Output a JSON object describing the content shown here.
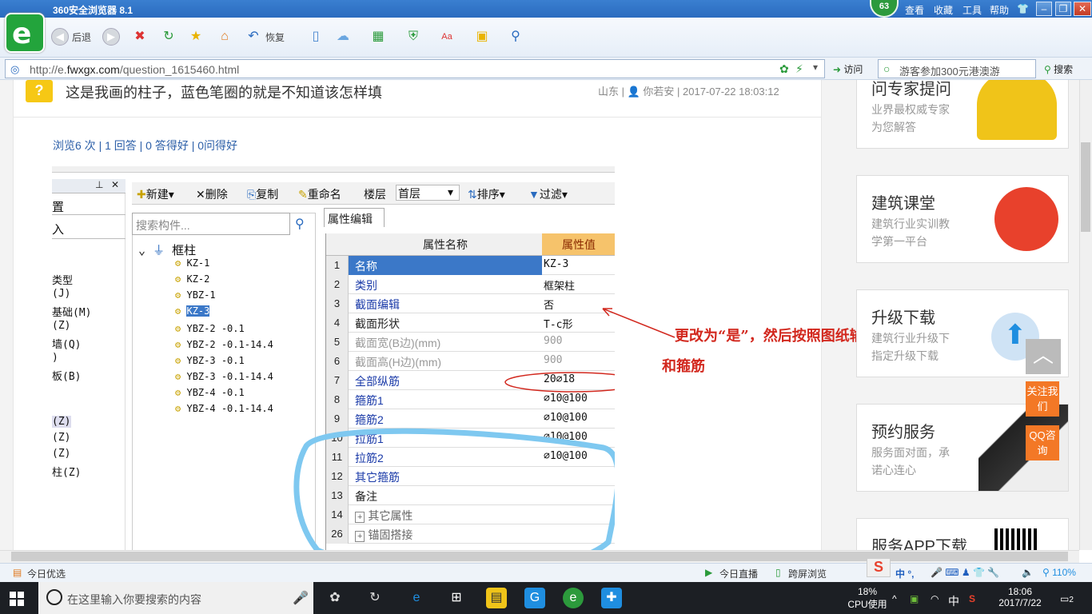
{
  "window": {
    "title": "360安全浏览器 8.1",
    "badge": "63",
    "menu": [
      "查看",
      "收藏",
      "工具",
      "帮助"
    ]
  },
  "toolbar": {
    "back": "后退",
    "restore": "恢复"
  },
  "address": {
    "url_prefix": "http://e.",
    "url_domain": "fwxgx.com",
    "url_path": "/question_1615460.html",
    "visit": "访问",
    "search_placeholder": "游客参加300元港澳游",
    "search_button": "搜索"
  },
  "question": {
    "title": "这是我画的柱子，蓝色笔圈的就是不知道该怎样填",
    "meta": "山东 | 👤 你若安 | 2017-07-22 18:03:12",
    "stats": "浏览6 次 | 1 回答 | 0 答得好 | 0问得好"
  },
  "screenshot": {
    "left_items": [
      "置",
      "入",
      "类型",
      "(J)",
      "基础(M)",
      "(Z)",
      "墙(Q)",
      ")",
      "板(B)",
      "(Z)",
      "(Z)",
      "(Z)",
      "柱(Z)"
    ],
    "toolbar": [
      "新建",
      "删除",
      "复制",
      "重命名",
      "楼层",
      "首层",
      "排序",
      "过滤"
    ],
    "search_placeholder": "搜索构件...",
    "tree_root": "框柱",
    "tree_items": [
      "KZ-1",
      "KZ-2",
      "YBZ-1",
      "KZ-3",
      "YBZ-2 -0.1",
      "YBZ-2 -0.1-14.4",
      "YBZ-3 -0.1",
      "YBZ-3 -0.1-14.4",
      "YBZ-4 -0.1",
      "YBZ-4 -0.1-14.4"
    ],
    "tab": "属性编辑",
    "col_name": "属性名称",
    "col_value": "属性值",
    "rows": [
      {
        "num": "1",
        "name": "名称",
        "value": "KZ-3"
      },
      {
        "num": "2",
        "name": "类别",
        "value": "框架柱"
      },
      {
        "num": "3",
        "name": "截面编辑",
        "value": "否"
      },
      {
        "num": "4",
        "name": "截面形状",
        "value": "T-c形"
      },
      {
        "num": "5",
        "name": "截面宽(B边)(mm)",
        "value": "900"
      },
      {
        "num": "6",
        "name": "截面高(H边)(mm)",
        "value": "900"
      },
      {
        "num": "7",
        "name": "全部纵筋",
        "value": "20⌀18"
      },
      {
        "num": "8",
        "name": "箍筋1",
        "value": "⌀10@100"
      },
      {
        "num": "9",
        "name": "箍筋2",
        "value": "⌀10@100"
      },
      {
        "num": "10",
        "name": "拉筋1",
        "value": "⌀10@100"
      },
      {
        "num": "11",
        "name": "拉筋2",
        "value": "⌀10@100"
      },
      {
        "num": "12",
        "name": "其它箍筋",
        "value": ""
      },
      {
        "num": "13",
        "name": "备注",
        "value": ""
      },
      {
        "num": "14",
        "name": "其它属性",
        "value": ""
      },
      {
        "num": "26",
        "name": "锚固搭接",
        "value": ""
      }
    ]
  },
  "annotation": {
    "line1": "更改为“是”，然后按照图纸输入纵筋",
    "line2": "和箍筋"
  },
  "sidebar": [
    {
      "title": "问专家提问",
      "sub1": "业界最权威专家",
      "sub2": "为您解答"
    },
    {
      "title": "建筑课堂",
      "sub1": "建筑行业实训教",
      "sub2": "学第一平台"
    },
    {
      "title": "升级下载",
      "sub1": "建筑行业升级下",
      "sub2": "指定升级下载"
    },
    {
      "title": "预约服务",
      "sub1": "服务面对面，承",
      "sub2": "诺心连心"
    },
    {
      "title": "服务APP下载",
      "sub1": "",
      "sub2": ""
    }
  ],
  "float_buttons": {
    "follow": "关注我们",
    "qq": "QQ咨询"
  },
  "statusbar": {
    "left": "今日优选",
    "live": "今日直播",
    "cross": "跨屏浏览",
    "zoom": "110%",
    "ime": "中 °,"
  },
  "taskbar": {
    "search_placeholder": "在这里输入你要搜索的内容",
    "cpu_pct": "18%",
    "cpu_label": "CPU使用",
    "time": "18:06",
    "date": "2017/7/22",
    "lang": "中",
    "notif": "2"
  },
  "colors": {
    "accent": "#2c5fa8",
    "annotation": "#d2281e",
    "blue_circle": "#7ec8f0",
    "orange": "#f37826"
  }
}
